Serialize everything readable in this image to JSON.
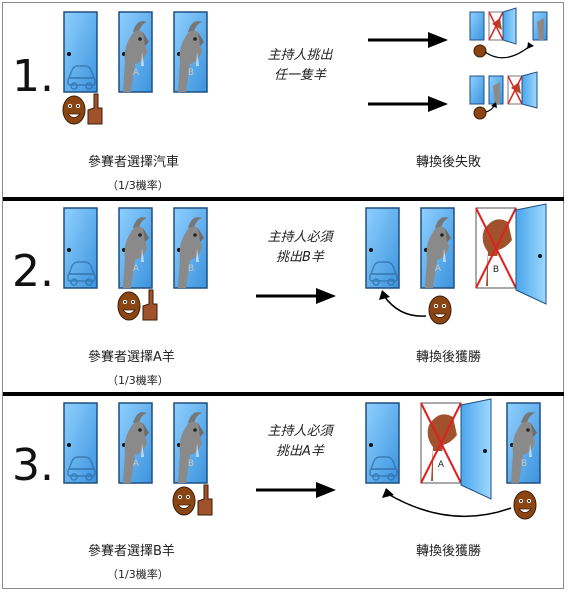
{
  "rows": [
    {
      "number": "1.",
      "choice": "參賽者選擇汽車",
      "probability": "（1/3機率）",
      "host_note_line1": "主持人挑出",
      "host_note_line2": "任一隻羊",
      "outcome": "轉換後失敗"
    },
    {
      "number": "2.",
      "choice": "參賽者選擇A羊",
      "probability": "（1/3機率）",
      "host_note_line1": "主持人必須",
      "host_note_line2": "挑出B羊",
      "outcome": "轉換後獲勝"
    },
    {
      "number": "3.",
      "choice": "參賽者選擇B羊",
      "probability": "（1/3機率）",
      "host_note_line1": "主持人必須",
      "host_note_line2": "挑出A羊",
      "outcome": "轉換後獲勝"
    }
  ],
  "goat_labels": {
    "a": "A",
    "b": "B"
  },
  "colors": {
    "door": "#5aaee8",
    "door_dark": "#2f78b7",
    "goat": "#8a8a8a",
    "goat_brown": "#a0522d",
    "cross": "#e02020",
    "face": "#8b4513"
  }
}
